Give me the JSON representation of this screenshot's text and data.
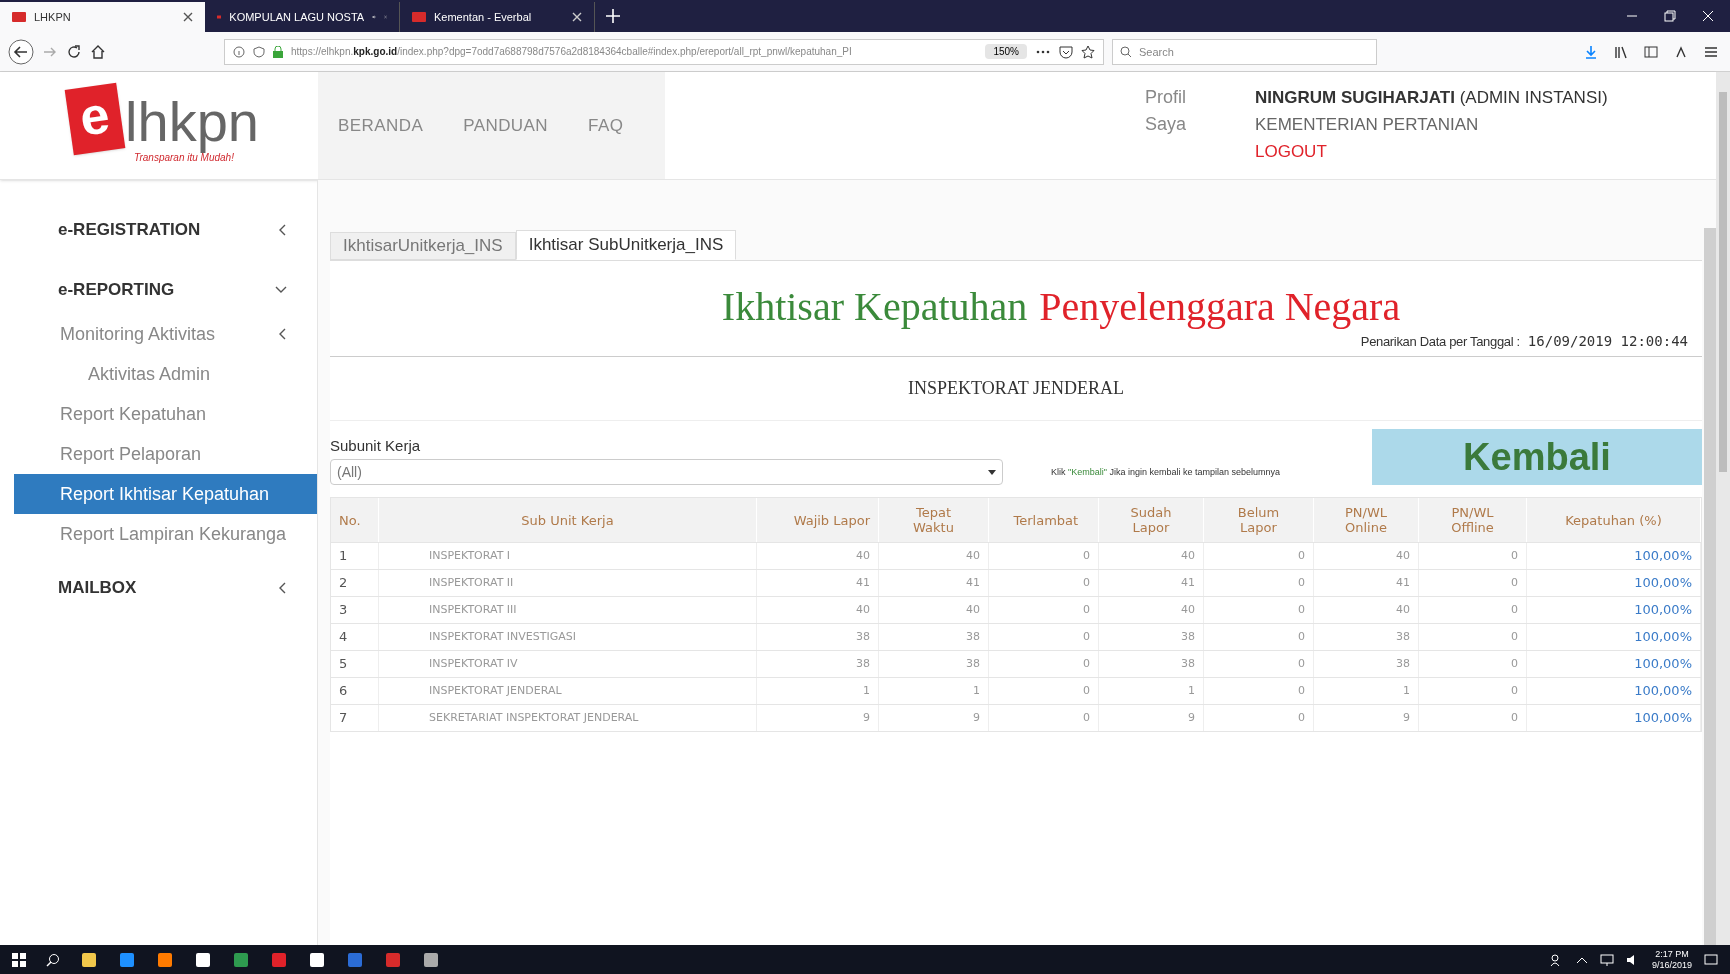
{
  "browser": {
    "tabs": [
      {
        "title": "LHKPN",
        "selected": true,
        "audio": false
      },
      {
        "title": "KOMPULAN LAGU NOSTA",
        "selected": false,
        "audio": true
      },
      {
        "title": "Kementan - Everbal",
        "selected": false,
        "audio": false
      }
    ],
    "url": {
      "host_before": "https://elhkpn.",
      "host_bold": "kpk.go.id",
      "path": "/index.php?dpg=7odd7a688798d7576a2d8184364cballe#index.php/ereport/all_rpt_pnwl/kepatuhan_PI"
    },
    "zoom": "150%",
    "search": {
      "placeholder": "Search"
    }
  },
  "logo": {
    "mark": "e",
    "text": "lhkpn",
    "tagline": "Transparan itu Mudah!"
  },
  "nav": [
    "BERANDA",
    "PANDUAN",
    "FAQ"
  ],
  "profile_link": "Profil Saya",
  "user": {
    "name": "**NINGRUM SUGIHARJATI** (ADMIN INSTANSI)",
    "org": "KEMENTERIAN PERTANIAN",
    "logout": "LOGOUT"
  },
  "sidebar": {
    "items": [
      {
        "label": "e-REGISTRATION",
        "kind": "section",
        "expanded": false
      },
      {
        "label": "e-REPORTING",
        "kind": "section",
        "expanded": true,
        "children": [
          {
            "label": "Monitoring Aktivitas",
            "kind": "group",
            "expanded": false,
            "selected": false,
            "children": [
              {
                "label": "Aktivitas Admin",
                "kind": "link",
                "selected": false
              }
            ]
          },
          {
            "label": "Report Kepatuhan",
            "kind": "link",
            "selected": false
          },
          {
            "label": "Report Pelaporan",
            "kind": "link",
            "selected": false
          },
          {
            "label": "Report Ikhtisar Kepatuhan",
            "kind": "link",
            "selected": true
          },
          {
            "label": "Report Lampiran Kekuranga",
            "kind": "link",
            "selected": false
          }
        ]
      },
      {
        "label": "MAILBOX",
        "kind": "section",
        "expanded": false
      }
    ]
  },
  "report_tabs": [
    {
      "label": "IkhtisarUnitkerja_INS",
      "selected": false
    },
    {
      "label": "Ikhtisar SubUnitkerja_INS",
      "selected": true
    }
  ],
  "title": [
    "Ikhtisar Kepatuhan",
    "Penyelenggara Negara"
  ],
  "data_date": {
    "label": "Penarikan Data per Tanggal :",
    "value": "16/09/2019 12:00:44"
  },
  "unit": "INSPEKTORAT JENDERAL",
  "filter": {
    "label": "Subunit Kerja",
    "value": "(All)"
  },
  "note": {
    "before": "Klik ",
    "link": "\"Kembali\"",
    "after": " Jika ingin kembali ke tampilan sebelumnya"
  },
  "back_button": "Kembali",
  "table": {
    "columns": [
      "No.",
      "Sub Unit Kerja",
      "Wajib Lapor",
      "Tepat Waktu",
      "Terlambat",
      "Sudah Lapor",
      "Belum Lapor",
      "PN/WL Online",
      "PN/WL Offline",
      "Kepatuhan (%)"
    ],
    "rows": [
      [
        "1",
        "INSPEKTORAT I",
        "40",
        "40",
        "0",
        "40",
        "0",
        "40",
        "0",
        "100,00%"
      ],
      [
        "2",
        "INSPEKTORAT II",
        "41",
        "41",
        "0",
        "41",
        "0",
        "41",
        "0",
        "100,00%"
      ],
      [
        "3",
        "INSPEKTORAT III",
        "40",
        "40",
        "0",
        "40",
        "0",
        "40",
        "0",
        "100,00%"
      ],
      [
        "4",
        "INSPEKTORAT INVESTIGASI",
        "38",
        "38",
        "0",
        "38",
        "0",
        "38",
        "0",
        "100,00%"
      ],
      [
        "5",
        "INSPEKTORAT IV",
        "38",
        "38",
        "0",
        "38",
        "0",
        "38",
        "0",
        "100,00%"
      ],
      [
        "6",
        "INSPEKTORAT JENDERAL",
        "1",
        "1",
        "0",
        "1",
        "0",
        "1",
        "0",
        "100,00%"
      ],
      [
        "7",
        "SEKRETARIAT INSPEKTORAT JENDERAL",
        "9",
        "9",
        "0",
        "9",
        "0",
        "9",
        "0",
        "100,00%"
      ]
    ]
  },
  "taskbar": {
    "time": "2:17 PM",
    "date": "9/16/2019"
  }
}
